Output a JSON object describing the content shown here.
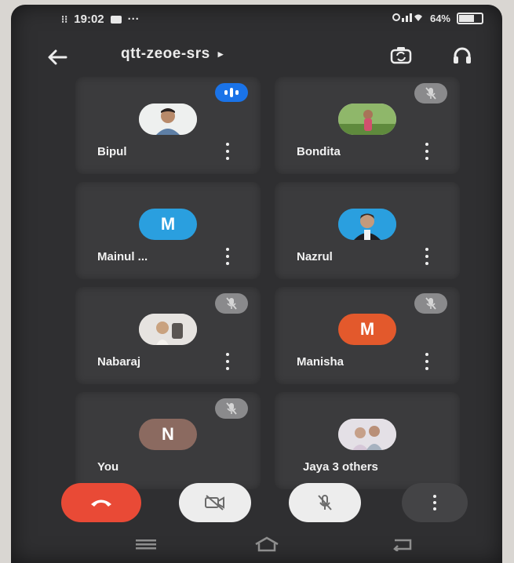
{
  "status_bar": {
    "time": "19:02",
    "dots": "···",
    "battery": "64%"
  },
  "header": {
    "meeting_code": "qtt-zeoe-srs",
    "caret": "▸"
  },
  "participants": [
    {
      "name": "Bipul",
      "avatar_type": "photo",
      "indicator": "speaking",
      "has_menu": true
    },
    {
      "name": "Bondita",
      "avatar_type": "photo",
      "indicator": "muted",
      "has_menu": true
    },
    {
      "name": "Mainul ...",
      "avatar_type": "letter",
      "letter": "M",
      "color": "#2a9fdf",
      "indicator": "none",
      "has_menu": true
    },
    {
      "name": "Nazrul",
      "avatar_type": "photo",
      "indicator": "none",
      "has_menu": true
    },
    {
      "name": "Nabaraj",
      "avatar_type": "photo",
      "indicator": "muted",
      "has_menu": true
    },
    {
      "name": "Manisha",
      "avatar_type": "letter",
      "letter": "M",
      "color": "#e3592c",
      "indicator": "muted",
      "has_menu": true
    },
    {
      "name": "You",
      "avatar_type": "letter",
      "letter": "N",
      "color": "#8b6a60",
      "indicator": "muted",
      "has_menu": false
    },
    {
      "name": "Jaya   3 others",
      "avatar_type": "photo",
      "indicator": "none",
      "has_menu": false
    }
  ],
  "controls": {
    "end_call": "phone-end-icon",
    "camera": "camera-off-icon",
    "microphone": "mic-off-icon",
    "more": "more-vert-icon"
  },
  "colors": {
    "end_call_red": "#e94a36",
    "speaking_blue": "#1a73e8",
    "background": "#2f2f31"
  }
}
